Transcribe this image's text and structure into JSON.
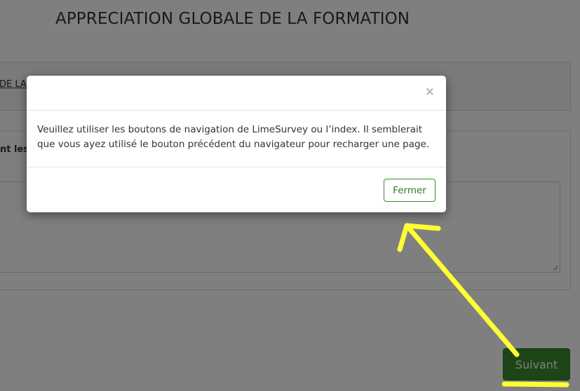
{
  "page": {
    "title": "APPRECIATION GLOBALE DE LA FORMATION",
    "group_text": "DE LA",
    "question_text": "nt les",
    "next_label": "Suivant"
  },
  "modal": {
    "message": "Veuillez utiliser les boutons de navigation de LimeSurvey ou l’index. Il semblerait que vous ayez utilisé le bouton précédent du navigateur pour recharger une page.",
    "close_symbol": "×",
    "button_label": "Fermer"
  },
  "colors": {
    "accent": "#3b8a2e",
    "annotation": "#ffff33",
    "overlay": "rgba(0,0,0,0.5)"
  },
  "icons": {
    "close": "close-icon",
    "resize": "resize-handle-icon",
    "arrow": "annotation-arrow"
  }
}
